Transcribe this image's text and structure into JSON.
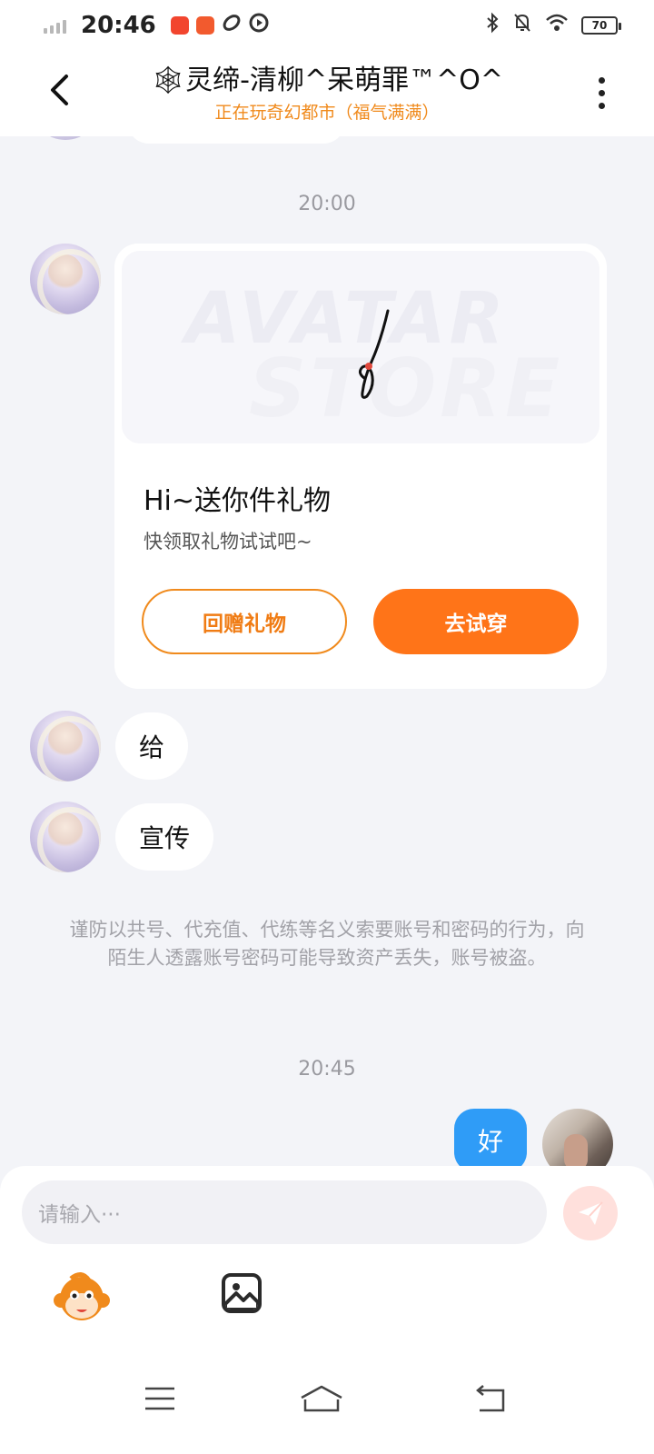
{
  "status_bar": {
    "time": "20:46",
    "battery": "70",
    "icons": [
      "signal-icon",
      "app-icon-1",
      "app-icon-2",
      "sync-icon",
      "play-icon",
      "bluetooth-icon",
      "mute-bell-icon",
      "wifi-icon",
      "battery-icon"
    ]
  },
  "header": {
    "title": "🕸灵缔-清柳^呆萌罪™^O^",
    "subtitle": "正在玩奇幻都市（福气满满）",
    "back_icon": "back-chevron-icon",
    "more_icon": "more-vertical-icon"
  },
  "chat": {
    "time_1": "20:00",
    "gift_card": {
      "watermark_line1": "AVATAR",
      "watermark_line2": "STORE",
      "title": "Hi~送你件礼物",
      "description": "快领取礼物试试吧~",
      "return_gift_label": "回赠礼物",
      "try_on_label": "去试穿"
    },
    "messages_left": [
      "给",
      "宣传"
    ],
    "notice": "谨防以共号、代充值、代练等名义索要账号和密码的行为，向陌生人透露账号密码可能导致资产丢失，账号被盗。",
    "time_2": "20:45",
    "message_right": "好"
  },
  "input": {
    "placeholder": "请输入···",
    "send_icon": "send-icon",
    "emoji_icon": "monkey-emoji-icon",
    "image_icon": "image-icon"
  },
  "colors": {
    "accent_orange": "#ff7418",
    "subtitle_orange": "#f08a1c",
    "my_bubble_blue": "#2f9cf7",
    "background": "#f3f4f8"
  },
  "nav": {
    "icons": [
      "menu-icon",
      "home-icon",
      "back-icon"
    ]
  }
}
